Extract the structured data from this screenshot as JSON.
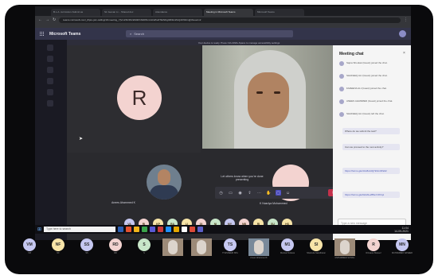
{
  "browser": {
    "tabs": [
      {
        "label": "B.L.A. curriculum-Submit as",
        "active": false
      },
      {
        "label": "Sir Jeevan Lt. - Shared doc",
        "active": false
      },
      {
        "label": "Attendance",
        "active": false
      },
      {
        "label": "Meeting in Microsoft Teams",
        "active": true
      },
      {
        "label": "Microsoft Teams",
        "active": false
      }
    ],
    "url": "teams.microsoft.com/_#/pre-join-calling/19:meeting_YjVmZDc3NzktM2FhNi00NmUxLWIwZTEtNDg0ZDk1ZGQ4OWUx@thread.v2"
  },
  "teams": {
    "app_title": "Microsoft Teams",
    "search_placeholder": "Search",
    "info_bar": "Your device is ready. Press Ctrl+Shift+Space to manage accessibility settings"
  },
  "stage": {
    "participant_initial": "R",
    "man_name": "Anees Ahammed K",
    "share_tip": "Let others know when you're done presenting",
    "pink_name": "K Nasriya Mohammed",
    "avatar_row": [
      {
        "initials": "VA",
        "color": "#c5c7f0"
      },
      {
        "initials": "RI",
        "color": "#f3d3d0"
      },
      {
        "initials": "KP",
        "color": "#f7e4a8"
      },
      {
        "initials": "RA",
        "color": "#c8e6c9"
      },
      {
        "initials": "LI",
        "color": "#f7e4a8"
      },
      {
        "initials": "GI",
        "color": "#f3d3d0"
      },
      {
        "initials": "NI",
        "color": "#c8e6c9"
      },
      {
        "initials": "MY",
        "color": "#c5c7f0"
      },
      {
        "initials": "NB",
        "color": "#f3d3d0"
      },
      {
        "initials": "RI",
        "color": "#f7e4a8"
      },
      {
        "initials": "SU",
        "color": "#c8e6c9"
      },
      {
        "initials": "HS",
        "color": "#f7e4a8"
      }
    ]
  },
  "chat": {
    "title": "Meeting chat",
    "messages": [
      {
        "text": "Sajna Shoukat (Guest) joined the chat."
      },
      {
        "text": "SHAFEEQ ALI (Guest) joined the chat."
      },
      {
        "text": "FAZEENA ALI (Guest) joined the chat."
      },
      {
        "text": "ANEES AHAMMED (Guest) joined the chat."
      },
      {
        "text": "SHAFEEQ ALI (Guest) left the chat."
      }
    ],
    "bubble_1": "Where do we submit the test?",
    "bubble_2": "Can we proceed to the next activity?",
    "bubble_3_link": "https://forms.gle/4Ux8sJdQ7kNm3Pa62",
    "bubble_4_link": "https://forms.gle/9Hr2tLwB5eYc8Vq1",
    "compose_placeholder": "Type a new message",
    "compose_tools": "Aa ☺ ⎘ ⊕ ➤"
  },
  "taskbar": {
    "search_text": "Type here to search",
    "time": "11:04",
    "date": "14-09-2021",
    "icon_colors": [
      "#2b5fb4",
      "#e5512f",
      "#f2b51b",
      "#3aa34a",
      "#5a5ad6",
      "#cc3a3a",
      "#1e90ff",
      "#e5a800",
      "#ffffff",
      "#dd4b39",
      "#5b5fc7"
    ]
  },
  "thumbnails": [
    {
      "initials": "VM",
      "name": "VM",
      "color": "#c5c7f0"
    },
    {
      "initials": "NF",
      "name": "NF",
      "color": "#f7e4a8"
    },
    {
      "initials": "SS",
      "name": "SS",
      "color": "#c5c7f0"
    },
    {
      "initials": "RD",
      "name": "RD",
      "color": "#f3d3d0"
    },
    {
      "initials": "S",
      "name": "S",
      "color": "#c8e6c9"
    },
    {
      "initials": "",
      "name": "",
      "color": "#9c8a78",
      "photo": true
    },
    {
      "initials": "",
      "name": "",
      "color": "#9c8a78",
      "photo": true
    },
    {
      "initials": "TS",
      "name": "THASNEEM SHA",
      "color": "#c5c7f0"
    },
    {
      "initials": "",
      "name": "Anees Ahammed K",
      "color": "#7a8a9a",
      "photo": true
    },
    {
      "initials": "M1",
      "name": "Mumtaz Sultana",
      "color": "#c5c7f0"
    },
    {
      "initials": "SI",
      "name": "Shaimola Sasidharan",
      "color": "#f7e4a8"
    },
    {
      "initials": "",
      "name": "MUHAMMED SUHAIL",
      "color": "#9c8a78",
      "photo": true
    },
    {
      "initials": "R",
      "name": "Rizwana Shareef",
      "color": "#f3d3d0"
    },
    {
      "initials": "MN",
      "name": "MUHAMMED NASEER",
      "color": "#c5c7f0"
    }
  ]
}
